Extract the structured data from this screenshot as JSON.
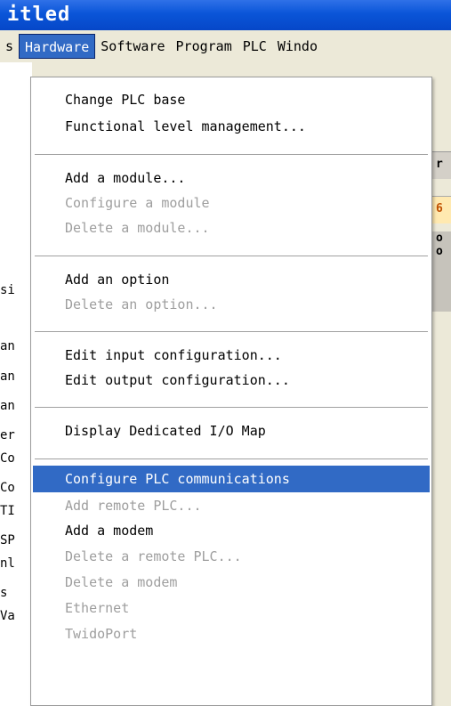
{
  "window": {
    "title": "itled"
  },
  "menubar": {
    "items": [
      {
        "label": "s"
      },
      {
        "label": "Hardware"
      },
      {
        "label": "Software"
      },
      {
        "label": "Program"
      },
      {
        "label": "PLC"
      },
      {
        "label": "Windo"
      }
    ]
  },
  "background": {
    "left_text": [
      "si",
      "an",
      "an",
      "an",
      "er",
      "Co",
      "Co",
      "TI",
      "SP",
      "nl",
      "s",
      "Va"
    ],
    "right_text": [
      "r",
      "6",
      "o o"
    ]
  },
  "menu": {
    "items": [
      {
        "label": "Change PLC base",
        "enabled": true
      },
      {
        "label": "Functional level management...",
        "enabled": true
      },
      {
        "label": "Add a module...",
        "enabled": true
      },
      {
        "label": "Configure a module",
        "enabled": false
      },
      {
        "label": "Delete a module...",
        "enabled": false
      },
      {
        "label": "Add an option",
        "enabled": true
      },
      {
        "label": "Delete an option...",
        "enabled": false
      },
      {
        "label": "Edit input configuration...",
        "enabled": true
      },
      {
        "label": "Edit output configuration...",
        "enabled": true
      },
      {
        "label": "Display Dedicated I/O Map",
        "enabled": true
      },
      {
        "label": "Configure PLC communications",
        "enabled": true,
        "highlighted": true
      },
      {
        "label": "Add remote PLC...",
        "enabled": false
      },
      {
        "label": "Add a modem",
        "enabled": true
      },
      {
        "label": "Delete a remote PLC...",
        "enabled": false
      },
      {
        "label": "Delete a modem",
        "enabled": false
      },
      {
        "label": "Ethernet",
        "enabled": false
      },
      {
        "label": "TwidoPort",
        "enabled": false
      }
    ]
  },
  "colors": {
    "highlight": "#316ac5",
    "disabled_text": "#9e9e9e",
    "titlebar": "#0a55d8"
  }
}
